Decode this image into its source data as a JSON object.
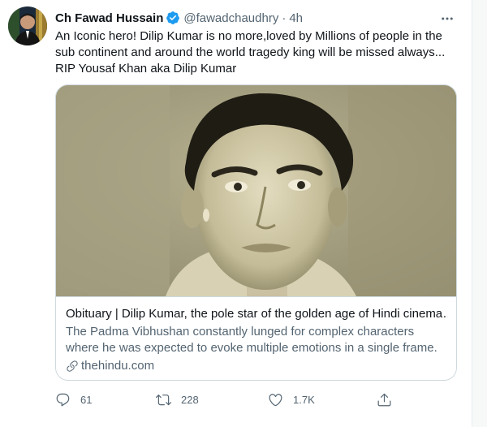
{
  "tweet": {
    "author": {
      "name": "Ch Fawad Hussain",
      "handle": "@fawadchaudhry",
      "verified_icon": "verified-badge-icon"
    },
    "separator": "·",
    "time": "4h",
    "text": "An Iconic hero! Dilip Kumar is no more,loved by Millions of people in the sub continent and around the world tragedy king will be missed always... RIP Yousaf Khan aka Dilip Kumar",
    "card": {
      "title": "Obituary | Dilip Kumar, the pole star of the golden age of Hindi cinema…",
      "description": "The Padma Vibhushan constantly lunged for complex characters where he was expected to evoke multiple emotions in a single frame.",
      "domain": "thehindu.com"
    },
    "actions": {
      "replies": "61",
      "retweets": "228",
      "likes": "1.7K"
    }
  },
  "colors": {
    "text_primary": "#0f1419",
    "text_secondary": "#536471",
    "verified_blue": "#1d9bf0",
    "border": "#cfd9de"
  }
}
